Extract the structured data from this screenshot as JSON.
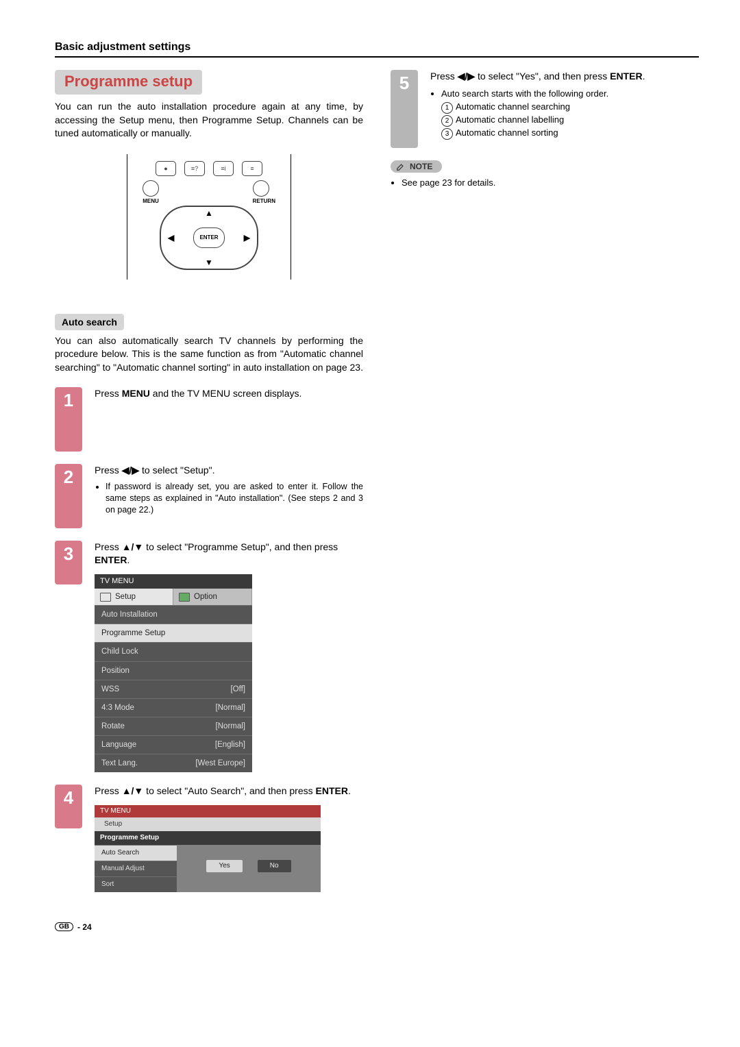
{
  "header": "Basic adjustment settings",
  "title": "Programme setup",
  "intro": "You can run the auto installation procedure again at any time, by accessing the Setup menu, then Programme Setup. Channels can be tuned automatically or manually.",
  "remote": {
    "menu": "MENU",
    "return": "RETURN",
    "enter": "ENTER"
  },
  "auto_search_heading": "Auto search",
  "auto_search_intro": "You can also automatically search TV channels by performing the procedure below. This is the same function as from \"Automatic channel searching\" to \"Automatic channel sorting\" in auto installation on page 23.",
  "steps": {
    "s1": {
      "num": "1",
      "text_a": "Press ",
      "menu": "MENU",
      "text_b": " and the TV MENU screen displays."
    },
    "s2": {
      "num": "2",
      "text_a": "Press ",
      "arrows": "◀/▶",
      "text_b": " to select \"Setup\".",
      "bullet": "If password is already set, you are asked to enter it. Follow the same steps as explained in \"Auto installation\". (See steps 2 and 3 on page 22.)"
    },
    "s3": {
      "num": "3",
      "text_a": "Press ",
      "arrows": "▲/▼",
      "text_b": " to select \"Programme Setup\", and then press ",
      "enter": "ENTER",
      "text_c": "."
    },
    "s4": {
      "num": "4",
      "text_a": "Press ",
      "arrows": "▲/▼",
      "text_b": " to select \"Auto Search\", and then press ",
      "enter": "ENTER",
      "text_c": "."
    },
    "s5": {
      "num": "5",
      "text_a": "Press ",
      "arrows": "◀/▶",
      "text_b": " to select \"Yes\", and then press ",
      "enter": "ENTER",
      "text_c": ".",
      "bullet_lead": "Auto search starts with the following order.",
      "sub1": "Automatic channel searching",
      "sub2": "Automatic channel labelling",
      "sub3": "Automatic channel sorting"
    }
  },
  "tvmenu": {
    "header": "TV MENU",
    "tab_setup": "Setup",
    "tab_option": "Option",
    "items": [
      {
        "label": "Auto Installation",
        "value": ""
      },
      {
        "label": "Programme Setup",
        "value": "",
        "selected": true
      },
      {
        "label": "Child Lock",
        "value": ""
      },
      {
        "label": "Position",
        "value": ""
      },
      {
        "label": "WSS",
        "value": "[Off]"
      },
      {
        "label": "4:3 Mode",
        "value": "[Normal]"
      },
      {
        "label": "Rotate",
        "value": "[Normal]"
      },
      {
        "label": "Language",
        "value": "[English]"
      },
      {
        "label": "Text Lang.",
        "value": "[West Europe]"
      }
    ]
  },
  "tvmenu2": {
    "header": "TV MENU",
    "tab_setup": "Setup",
    "crumb": "Programme Setup",
    "side": [
      {
        "label": "Auto Search",
        "selected": true
      },
      {
        "label": "Manual Adjust"
      },
      {
        "label": "Sort"
      }
    ],
    "yes": "Yes",
    "no": "No"
  },
  "note_label": "NOTE",
  "note_text": "See page 23 for details.",
  "footer": {
    "gb": "GB",
    "page": "- 24"
  }
}
